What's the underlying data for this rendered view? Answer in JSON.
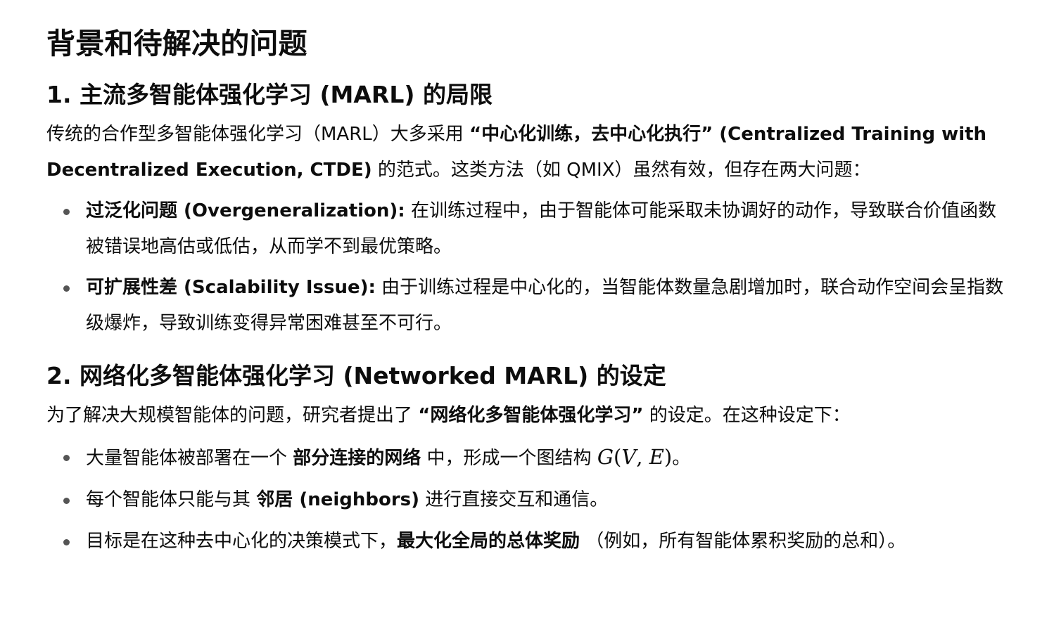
{
  "title": "背景和待解决的问题",
  "section1": {
    "heading": "1. 主流多智能体强化学习 (MARL) 的局限",
    "intro_1": "传统的合作型多智能体强化学习（MARL）大多采用 ",
    "intro_bold": "“中心化训练，去中心化执行” (Centralized Training with Decentralized Execution, CTDE)",
    "intro_2": " 的范式。这类方法（如 QMIX）虽然有效，但存在两大问题：",
    "bullets": [
      {
        "bold": "过泛化问题 (Overgeneralization):",
        "text": " 在训练过程中，由于智能体可能采取未协调好的动作，导致联合价值函数被错误地高估或低估，从而学不到最优策略。"
      },
      {
        "bold": "可扩展性差 (Scalability Issue):",
        "text": " 由于训练过程是中心化的，当智能体数量急剧增加时，联合动作空间会呈指数级爆炸，导致训练变得异常困难甚至不可行。"
      }
    ]
  },
  "section2": {
    "heading": "2. 网络化多智能体强化学习 (Networked MARL) 的设定",
    "intro_1": "为了解决大规模智能体的问题，研究者提出了 ",
    "intro_bold": "“网络化多智能体强化学习”",
    "intro_2": " 的设定。在这种设定下：",
    "bullets": [
      {
        "pre": "大量智能体被部署在一个 ",
        "bold": "部分连接的网络",
        "post": " 中，形成一个图结构 ",
        "math_G": "G",
        "math_open": "(",
        "math_V": "V",
        "math_comma": ", ",
        "math_E": "E",
        "math_close": ")",
        "end": "。"
      },
      {
        "pre": "每个智能体只能与其 ",
        "bold": "邻居 (neighbors)",
        "post": " 进行直接交互和通信。"
      },
      {
        "pre": "目标是在这种去中心化的决策模式下，",
        "bold": "最大化全局的总体奖励",
        "post": " （例如，所有智能体累积奖励的总和）。"
      }
    ]
  }
}
